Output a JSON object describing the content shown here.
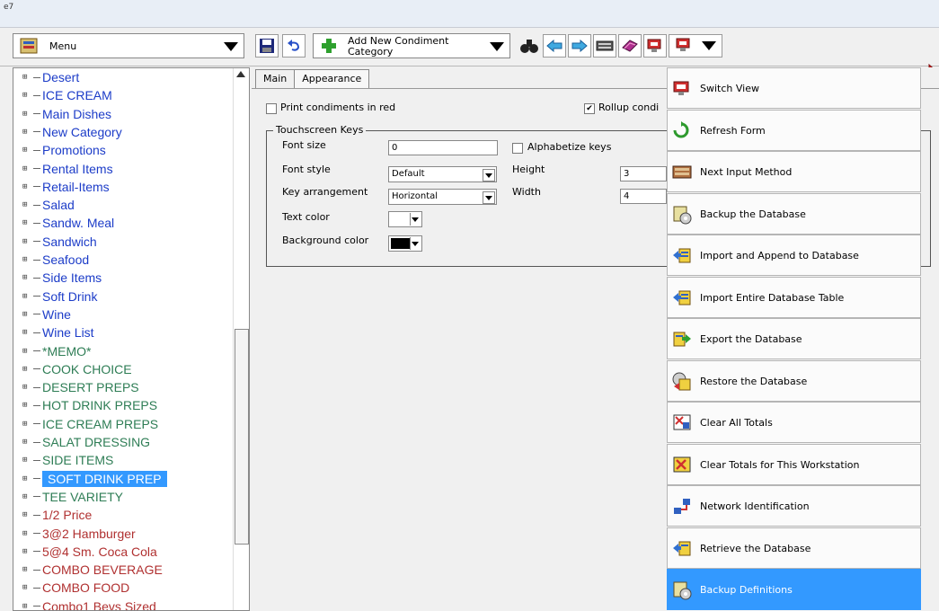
{
  "window": {
    "title": "e7"
  },
  "toolbar": {
    "menu_label": "Menu",
    "add_label_line1": "Add New Condiment",
    "add_label_line2": "Category"
  },
  "tree": {
    "items": [
      {
        "label": "Desert",
        "color": "blue"
      },
      {
        "label": "ICE CREAM",
        "color": "blue"
      },
      {
        "label": "Main Dishes",
        "color": "blue"
      },
      {
        "label": "New Category",
        "color": "blue"
      },
      {
        "label": "Promotions",
        "color": "blue"
      },
      {
        "label": "Rental Items",
        "color": "blue"
      },
      {
        "label": "Retail-Items",
        "color": "blue"
      },
      {
        "label": "Salad",
        "color": "blue"
      },
      {
        "label": "Sandw. Meal",
        "color": "blue"
      },
      {
        "label": "Sandwich",
        "color": "blue"
      },
      {
        "label": "Seafood",
        "color": "blue"
      },
      {
        "label": "Side Items",
        "color": "blue"
      },
      {
        "label": "Soft Drink",
        "color": "blue"
      },
      {
        "label": "Wine",
        "color": "blue"
      },
      {
        "label": "Wine List",
        "color": "blue"
      },
      {
        "label": "*MEMO*",
        "color": "green"
      },
      {
        "label": "COOK CHOICE",
        "color": "green"
      },
      {
        "label": "DESERT PREPS",
        "color": "green"
      },
      {
        "label": "HOT DRINK PREPS",
        "color": "green"
      },
      {
        "label": "ICE CREAM PREPS",
        "color": "green"
      },
      {
        "label": "SALAT DRESSING",
        "color": "green"
      },
      {
        "label": "SIDE ITEMS",
        "color": "green"
      },
      {
        "label": "SOFT DRINK PREP",
        "color": "selected"
      },
      {
        "label": "TEE VARIETY",
        "color": "green"
      },
      {
        "label": "1/2 Price",
        "color": "red"
      },
      {
        "label": "3@2 Hamburger",
        "color": "red"
      },
      {
        "label": "5@4 Sm. Coca Cola",
        "color": "red"
      },
      {
        "label": "COMBO BEVERAGE",
        "color": "red"
      },
      {
        "label": "COMBO FOOD",
        "color": "red"
      },
      {
        "label": "Combo1 Bevs Sized",
        "color": "red"
      }
    ]
  },
  "tabs": {
    "main": "Main",
    "appearance": "Appearance"
  },
  "form": {
    "print_red_label": "Print condiments in red",
    "print_red_checked": false,
    "rollup_label": "Rollup condi",
    "rollup_checked": true,
    "group_title": "Touchscreen Keys",
    "font_size_label": "Font size",
    "font_size_value": "0",
    "alphabetize_label": "Alphabetize keys",
    "alphabetize_checked": false,
    "font_style_label": "Font style",
    "font_style_value": "Default",
    "height_label": "Height",
    "height_value": "3",
    "key_arrangement_label": "Key arrangement",
    "key_arrangement_value": "Horizontal",
    "width_label": "Width",
    "width_value": "4",
    "text_color_label": "Text color",
    "text_color": "#ffffff",
    "bg_color_label": "Background color",
    "bg_color": "#000000"
  },
  "dropdown": {
    "items": [
      {
        "label": "Switch View",
        "icon": "switch-view-icon"
      },
      {
        "label": "Refresh Form",
        "icon": "refresh-icon"
      },
      {
        "label": "Next Input Method",
        "icon": "keyboard-icon"
      },
      {
        "label": "Backup the Database",
        "icon": "backup-icon"
      },
      {
        "label": "Import and Append to Database",
        "icon": "import-icon"
      },
      {
        "label": "Import Entire Database Table",
        "icon": "import-icon"
      },
      {
        "label": "Export the Database",
        "icon": "export-icon"
      },
      {
        "label": "Restore the Database",
        "icon": "restore-icon"
      },
      {
        "label": "Clear All Totals",
        "icon": "clear-totals-icon"
      },
      {
        "label": "Clear Totals for This Workstation",
        "icon": "clear-workstation-icon"
      },
      {
        "label": "Network Identification",
        "icon": "network-icon"
      },
      {
        "label": "Retrieve the Database",
        "icon": "retrieve-icon"
      },
      {
        "label": "Backup Definitions",
        "icon": "backup-icon"
      }
    ],
    "highlighted_index": 12
  },
  "colors": {
    "selection": "#3399ff",
    "blue_text": "#1c3cc8",
    "green_text": "#2e7d55",
    "red_text": "#b03030"
  }
}
